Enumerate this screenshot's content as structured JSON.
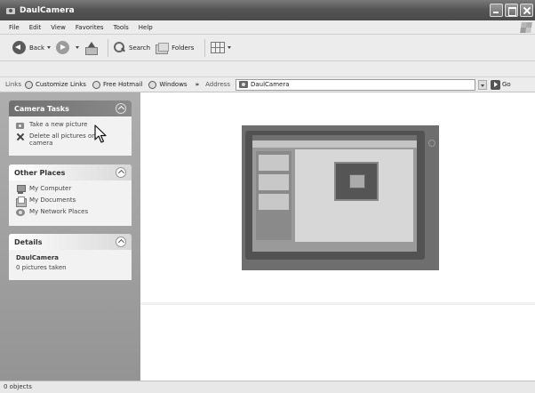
{
  "window": {
    "title": "DaulCamera"
  },
  "menu": [
    "File",
    "Edit",
    "View",
    "Favorites",
    "Tools",
    "Help"
  ],
  "toolbar": {
    "back": "Back",
    "search": "Search",
    "folders": "Folders"
  },
  "links": {
    "label": "Links",
    "items": [
      "Customize Links",
      "Free Hotmail",
      "Windows"
    ],
    "more": "»"
  },
  "address": {
    "label": "Address",
    "value": "DaulCamera",
    "go": "Go"
  },
  "camera_tasks": {
    "title": "Camera Tasks",
    "take_new": "Take a new picture",
    "delete_all_1": "Delete all pictures on",
    "delete_all_2": "camera"
  },
  "other_places": {
    "title": "Other Places",
    "items": [
      "My Computer",
      "My Documents",
      "My Network Places"
    ]
  },
  "details": {
    "title": "Details",
    "name": "DaulCamera",
    "info": "0 pictures taken"
  },
  "status": {
    "text": "0 objects"
  }
}
